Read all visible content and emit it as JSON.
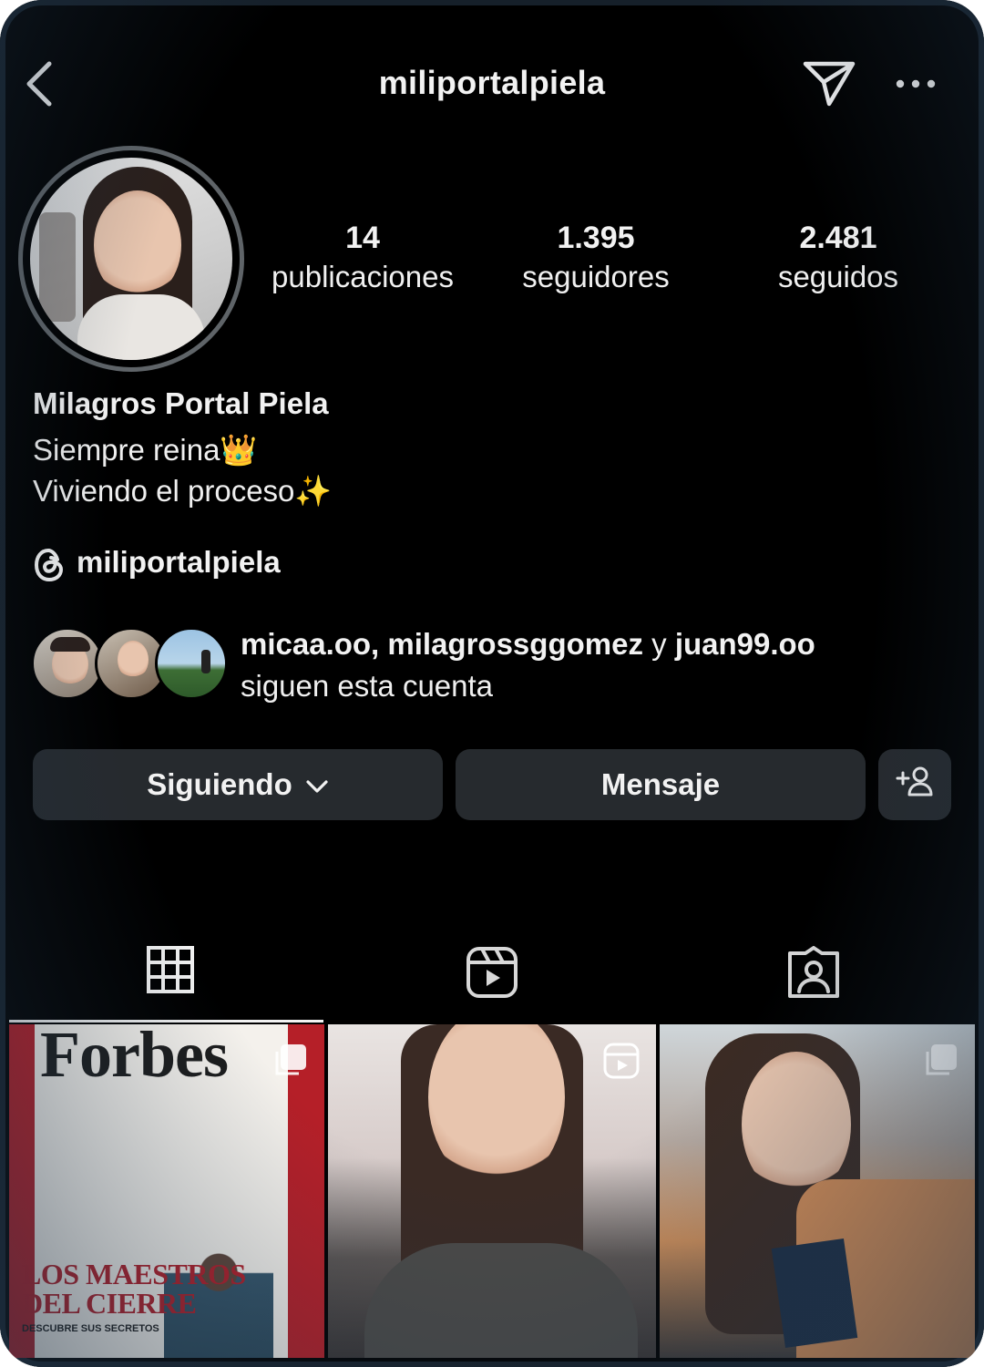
{
  "header": {
    "username": "miliportalpiela"
  },
  "stats": [
    {
      "value": "14",
      "label": "publicaciones"
    },
    {
      "value": "1.395",
      "label": "seguidores"
    },
    {
      "value": "2.481",
      "label": "seguidos"
    }
  ],
  "profile": {
    "full_name": "Milagros Portal Piela",
    "bio_line1": "Siempre reina👑",
    "bio_line2": "Viviendo el proceso✨",
    "threads_handle": "miliportalpiela"
  },
  "followed_by": {
    "names_part1": "micaa.oo, milagrossggomez",
    "connector": " y ",
    "names_part2": "juan99.oo",
    "subtitle": "siguen esta cuenta"
  },
  "actions": {
    "following_label": "Siguiendo",
    "message_label": "Mensaje"
  },
  "tabs": [
    "grid-icon",
    "reels-icon",
    "tagged-icon"
  ],
  "posts": [
    {
      "badge": "carousel-icon",
      "magazine_title": "Forbes",
      "headline_line1": "LOS MAESTROS",
      "headline_line2": "DEL CIERRE",
      "subline": "DESCUBRE SUS SECRETOS"
    },
    {
      "badge": "reels-icon"
    },
    {
      "badge": "carousel-icon"
    }
  ]
}
